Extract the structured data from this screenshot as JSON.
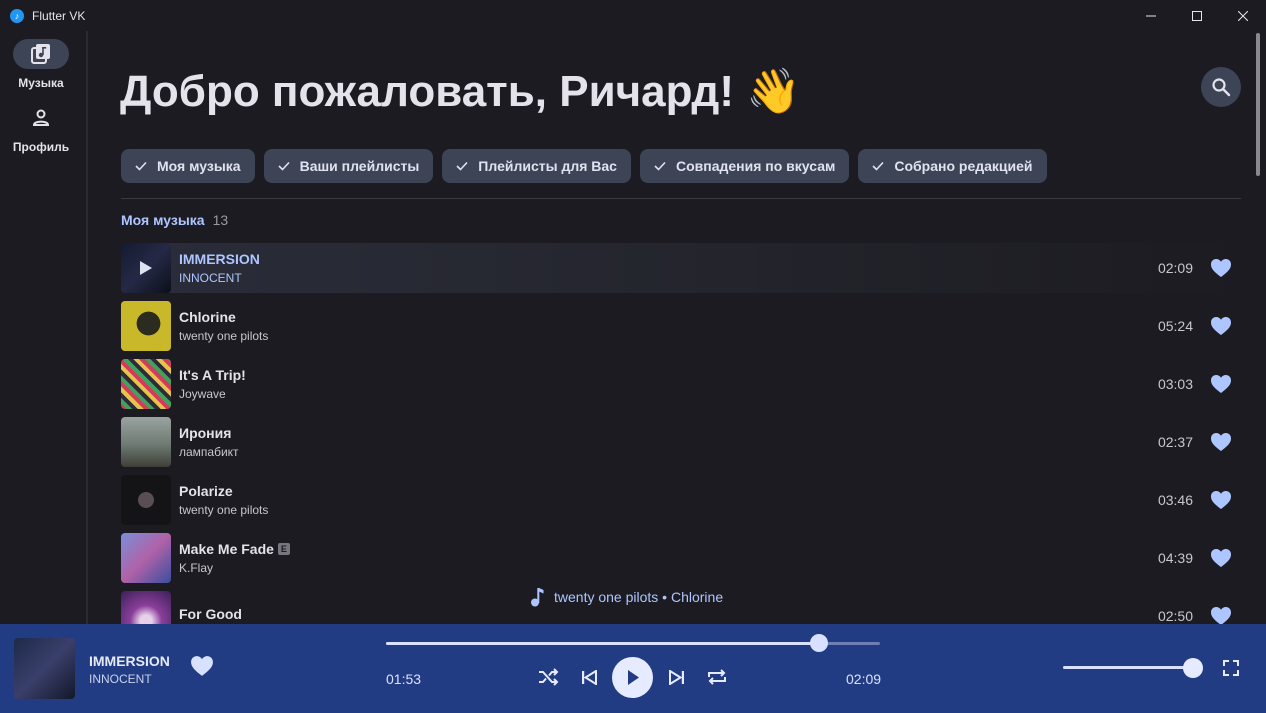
{
  "window": {
    "title": "Flutter VK",
    "controls": [
      "minimize",
      "maximize",
      "close"
    ]
  },
  "sidebar": {
    "items": [
      {
        "label": "Музыка",
        "icon": "music-library-icon",
        "active": true
      },
      {
        "label": "Профиль",
        "icon": "person-icon",
        "active": false
      }
    ]
  },
  "main": {
    "greeting": "Добро пожаловать, Ричард! 👋",
    "search_icon": "search-icon",
    "chips": [
      {
        "label": "Моя музыка",
        "checked": true
      },
      {
        "label": "Ваши плейлисты",
        "checked": true
      },
      {
        "label": "Плейлисты для Вас",
        "checked": true
      },
      {
        "label": "Совпадения по вкусам",
        "checked": true
      },
      {
        "label": "Собрано редакцией",
        "checked": true
      }
    ],
    "section": {
      "title": "Моя музыка",
      "count": "13"
    },
    "tracks": [
      {
        "title": "IMMERSION",
        "artist": "INNOCENT",
        "duration": "02:09",
        "liked": true,
        "current": true,
        "explicit": false
      },
      {
        "title": "Chlorine",
        "artist": "twenty one pilots",
        "duration": "05:24",
        "liked": true,
        "current": false,
        "explicit": false
      },
      {
        "title": "It's A Trip!",
        "artist": "Joywave",
        "duration": "03:03",
        "liked": true,
        "current": false,
        "explicit": false
      },
      {
        "title": "Ирония",
        "artist": "лампабикт",
        "duration": "02:37",
        "liked": true,
        "current": false,
        "explicit": false
      },
      {
        "title": "Polarize",
        "artist": "twenty one pilots",
        "duration": "03:46",
        "liked": true,
        "current": false,
        "explicit": false
      },
      {
        "title": "Make Me Fade",
        "artist": "K.Flay",
        "duration": "04:39",
        "liked": true,
        "current": false,
        "explicit": true,
        "explicit_label": "E"
      },
      {
        "title": "For Good",
        "artist": "",
        "duration": "02:50",
        "liked": true,
        "current": false,
        "explicit": false
      }
    ],
    "now_playing_hint": "twenty one pilots • Chlorine"
  },
  "player": {
    "title": "IMMERSION",
    "artist": "INNOCENT",
    "liked": true,
    "position": "01:53",
    "duration": "02:09",
    "progress_fraction": 0.876,
    "volume_fraction": 1.0,
    "controls": [
      "shuffle-icon",
      "previous-icon",
      "play-icon",
      "next-icon",
      "repeat-icon"
    ]
  },
  "colors": {
    "background": "#1c1b21",
    "accent": "#aec6ff",
    "chip": "#3d4456",
    "player": "#223c84"
  }
}
